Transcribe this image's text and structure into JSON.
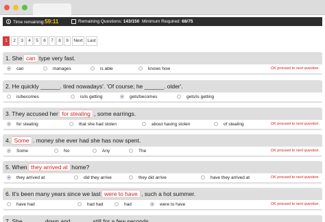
{
  "status": {
    "time_label": "Time remaining:",
    "time_value": "59:11",
    "remaining_label": "Remaining Questions:",
    "remaining_value": "143/150",
    "required_label": "Minimum Required:",
    "required_value": "68/75"
  },
  "pager": [
    "1",
    "2",
    "3",
    "4",
    "5",
    "6",
    "7",
    "8",
    "9",
    "Next",
    "Last"
  ],
  "pager_active": "1",
  "feedback": "OK proceed to next question.",
  "questions": [
    {
      "pre": "1. She",
      "hl": "can",
      "post": "type very fast.",
      "options": [
        "can",
        "manages",
        "is able",
        "knows how"
      ],
      "selected": 0,
      "feedback": true
    },
    {
      "pre": "2. He quickly ______. tired nowadays'. 'Of course; he ______. older'.",
      "hl": "",
      "post": "",
      "options": [
        "is/becomes",
        "is/is getting",
        "gets/becomes",
        "gets/is getting"
      ],
      "selected": 2,
      "feedback": false
    },
    {
      "pre": "3. They accused her",
      "hl": "for stealing",
      "post": ", some earrings.",
      "options": [
        "for stealing",
        "that she had stolen",
        "about having stolen",
        "of stealing"
      ],
      "selected": 0,
      "feedback": true
    },
    {
      "pre": "4.",
      "hl": "Some",
      "post": ". money she ever had she has now spent.",
      "options": [
        "Some",
        "No",
        "Any",
        "The"
      ],
      "selected": 0,
      "feedback": true
    },
    {
      "pre": "5. When",
      "hl": "they arrived at",
      "post": "home?",
      "options": [
        "they arrived at",
        "did they arrive",
        "they did arrive",
        "have they arrived at"
      ],
      "selected": 0,
      "feedback": true
    },
    {
      "pre": "6. It's been many years since we last",
      "hl": "were to have",
      "post": ", such a hot summer.",
      "options": [
        "have had",
        "had had",
        "had",
        "were to have"
      ],
      "selected": 3,
      "feedback": true
    },
    {
      "pre": "7. She ______ down and ______ still for a few seconds.",
      "hl": "",
      "post": "",
      "options": [],
      "selected": -1,
      "feedback": false
    }
  ]
}
